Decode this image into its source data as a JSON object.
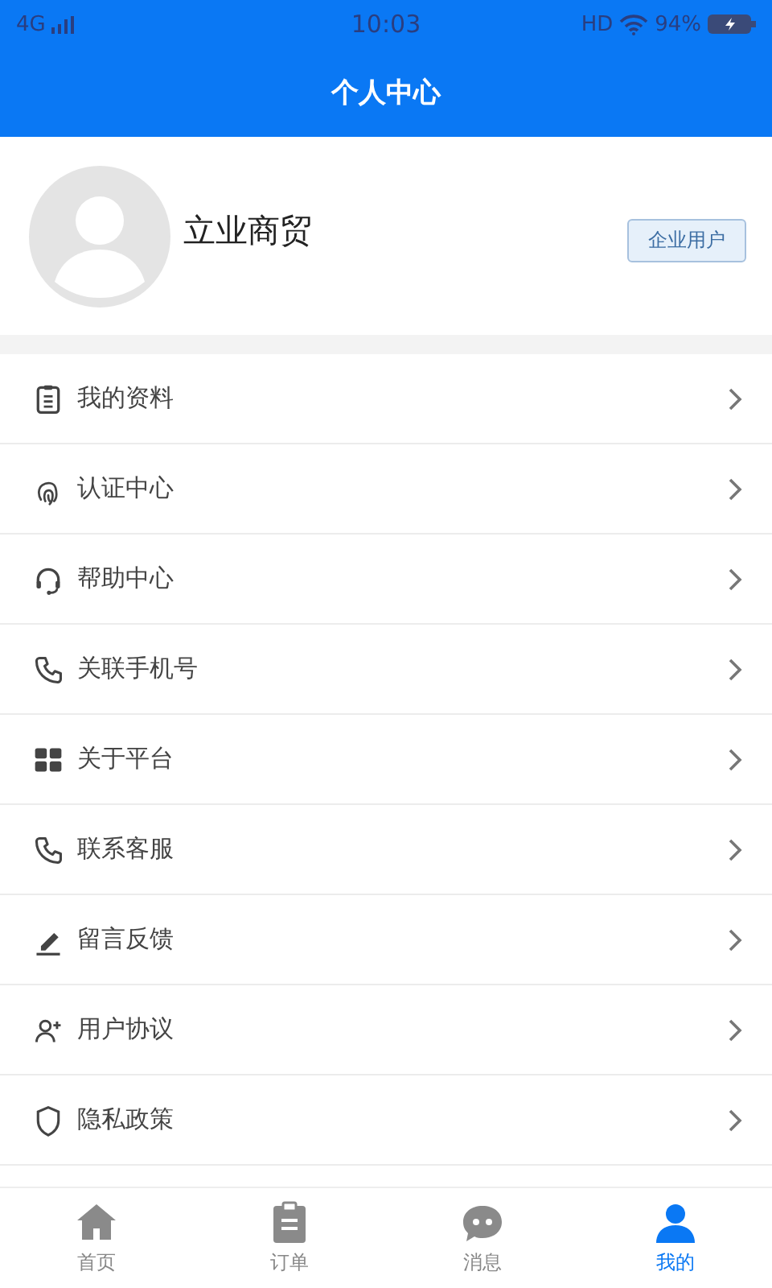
{
  "status_bar": {
    "network": "4G",
    "time": "10:03",
    "hd": "HD",
    "battery": "94%"
  },
  "nav_bar": {
    "title": "个人中心"
  },
  "profile": {
    "name": "立业商贸",
    "badge": "企业用户"
  },
  "menu": [
    {
      "label": "我的资料",
      "kind": "clipboard"
    },
    {
      "label": "认证中心",
      "kind": "fingerprint"
    },
    {
      "label": "帮助中心",
      "kind": "headset"
    },
    {
      "label": "关联手机号",
      "kind": "phone"
    },
    {
      "label": "关于平台",
      "kind": "grid"
    },
    {
      "label": "联系客服",
      "kind": "phone"
    },
    {
      "label": "留言反馈",
      "kind": "pencil"
    },
    {
      "label": "用户协议",
      "kind": "user-plus"
    },
    {
      "label": "隐私政策",
      "kind": "shield"
    }
  ],
  "tab_bar": [
    {
      "label": "首页",
      "kind": "home",
      "selected": false
    },
    {
      "label": "订单",
      "kind": "clipboard",
      "selected": false
    },
    {
      "label": "消息",
      "kind": "chat",
      "selected": false
    },
    {
      "label": "我的",
      "kind": "person",
      "selected": true
    }
  ]
}
